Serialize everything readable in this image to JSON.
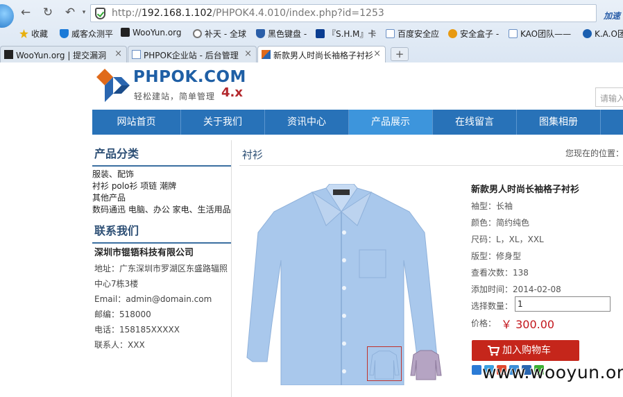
{
  "browser": {
    "url_prefix": "http://",
    "url_host": "192.168.1.102",
    "url_path": "/PHPOK4.4.010/index.php?id=1253",
    "accelerate": "加速",
    "bookmarks": [
      {
        "label": "收藏",
        "icon": "star-icon",
        "color": "#e8b00f"
      },
      {
        "label": "威客众测平",
        "icon": "shield-icon",
        "color": "#1a7ad8"
      },
      {
        "label": "WooYun.org",
        "icon": "wooyun-icon",
        "color": "#222222"
      },
      {
        "label": "补天 - 全球",
        "icon": "butian-icon",
        "color": "#777777"
      },
      {
        "label": "黑色键盘 -",
        "icon": "keyboard-shield-icon",
        "color": "#2a5ea8"
      },
      {
        "label": "『S.H.M』卡",
        "icon": "shm-icon",
        "color": "#0a3d91"
      },
      {
        "label": "百度安全应",
        "icon": "page-icon",
        "color": "#6a8fc4"
      },
      {
        "label": "安全盒子 -",
        "icon": "box-icon",
        "color": "#e89a12"
      },
      {
        "label": "KAO团队——",
        "icon": "page-icon",
        "color": "#6a8fc4"
      },
      {
        "label": "K.A.O团",
        "icon": "kao-icon",
        "color": "#1a5fb0"
      }
    ],
    "tabs": [
      {
        "label": "WooYun.org | 提交漏洞",
        "icon": "wooyun-icon"
      },
      {
        "label": "PHPOK企业站 - 后台管理",
        "icon": "page-icon"
      },
      {
        "label": "新款男人时尚长袖格子衬衫",
        "icon": "phpok-icon"
      }
    ],
    "close_glyph": "×",
    "new_tab_glyph": "+"
  },
  "site": {
    "brand_name": "PHPOK.COM",
    "slogan": "轻松建站，简单管理",
    "version": "4.x",
    "search_placeholder": "请输入"
  },
  "menu": [
    {
      "label": "网站首页",
      "active": false
    },
    {
      "label": "关于我们",
      "active": false
    },
    {
      "label": "资讯中心",
      "active": false
    },
    {
      "label": "产品展示",
      "active": true
    },
    {
      "label": "在线留言",
      "active": false
    },
    {
      "label": "图集相册",
      "active": false
    }
  ],
  "sidebar": {
    "categories_title": "产品分类",
    "categories": [
      "服装、配饰",
      "衬衫 polo衫 项链 潮牌",
      "其他产品",
      "数码通迅 电脑、办公 家电、生活用品"
    ],
    "contact_title": "联系我们",
    "company": "深圳市锟铻科技有限公司",
    "address_1": "地址：广东深圳市罗湖区东盛路辐照",
    "address_2": "中心7栋3楼",
    "email": "Email：admin@domain.com",
    "postcode": "邮编：518000",
    "phone": "电话：158185XXXXX",
    "contact_person": "联系人：XXX"
  },
  "content": {
    "category_title": "衬衫",
    "location_label": "您现在的位置："
  },
  "product": {
    "title": "新款男人时尚长袖格子衬衫",
    "attributes": [
      "袖型：长袖",
      "颜色：简约纯色",
      "尺码：L，XL，XXL",
      "版型：修身型",
      "查看次数：138",
      "添加时间：2014-02-08"
    ],
    "quantity_label": "选择数量：",
    "quantity_value": "1",
    "price_label": "价格：",
    "price": "￥ 300.00",
    "add_to_cart": "加入购物车",
    "colors": {
      "shirt_main": "#a9c8ec",
      "shirt_thumb_2": "#b5a4c3",
      "price": "#c3161c",
      "button": "#c5261b"
    }
  },
  "watermark": "www.wooyun.org"
}
